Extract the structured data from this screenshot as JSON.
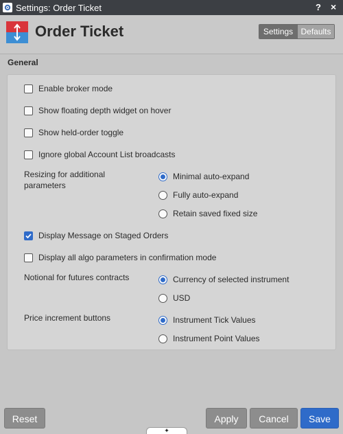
{
  "window": {
    "title": "Settings: Order Ticket",
    "help_glyph": "?",
    "close_glyph": "×",
    "icon": "gear-icon"
  },
  "header": {
    "title": "Order Ticket",
    "logo_icon": "order-ticket-icon",
    "tabs": [
      {
        "label": "Settings",
        "active": true
      },
      {
        "label": "Defaults",
        "active": false
      }
    ]
  },
  "section": {
    "title": "General"
  },
  "settings": {
    "enable_broker_mode": {
      "label": "Enable broker mode",
      "checked": false
    },
    "floating_depth": {
      "label": "Show floating depth widget on hover",
      "checked": false
    },
    "held_order_toggle": {
      "label": "Show held-order toggle",
      "checked": false
    },
    "ignore_broadcasts": {
      "label": "Ignore global Account List broadcasts",
      "checked": false
    },
    "resizing": {
      "label": "Resizing for additional parameters",
      "options": [
        {
          "label": "Minimal auto-expand",
          "selected": true
        },
        {
          "label": "Fully auto-expand",
          "selected": false
        },
        {
          "label": "Retain saved fixed size",
          "selected": false
        }
      ]
    },
    "display_message": {
      "label": "Display Message on Staged Orders",
      "checked": true
    },
    "algo_params": {
      "label": "Display all algo parameters in confirmation mode",
      "checked": false
    },
    "notional": {
      "label": "Notional for futures contracts",
      "options": [
        {
          "label": "Currency of selected instrument",
          "selected": true
        },
        {
          "label": "USD",
          "selected": false
        }
      ]
    },
    "price_increment": {
      "label": "Price increment buttons",
      "options": [
        {
          "label": "Instrument Tick Values",
          "selected": true
        },
        {
          "label": "Instrument Point Values",
          "selected": false
        }
      ]
    }
  },
  "footer": {
    "reset": "Reset",
    "apply": "Apply",
    "cancel": "Cancel",
    "save": "Save",
    "grip_glyph": "✦"
  },
  "colors": {
    "accent": "#2f6bc9",
    "titlebar": "#3c3f44",
    "logo_red": "#d9353b",
    "logo_blue": "#3d8ed4"
  }
}
